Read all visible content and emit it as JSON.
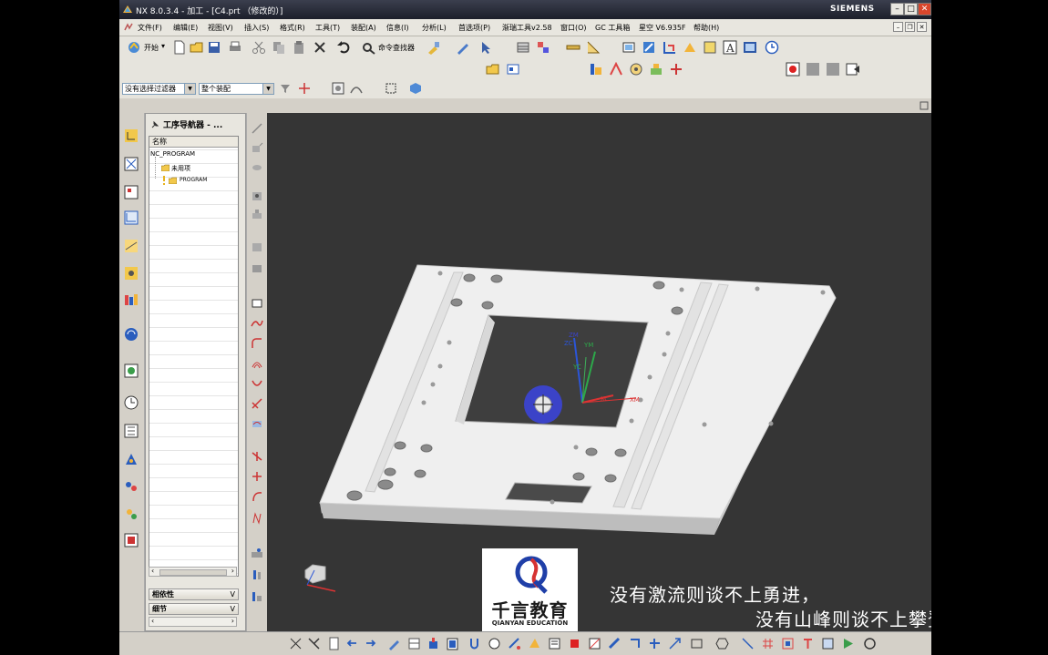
{
  "window": {
    "title": "NX 8.0.3.4 - 加工 - [C4.prt （修改的）]",
    "brand": "SIEMENS"
  },
  "menu": [
    "文件(F)",
    "编辑(E)",
    "视图(V)",
    "插入(S)",
    "格式(R)",
    "工具(T)",
    "装配(A)",
    "信息(I)",
    "分析(L)",
    "首选项(P)",
    "渐瑞工具v2.58",
    "窗口(O)",
    "GC 工具箱",
    "星空 V6.935F",
    "帮助(H)"
  ],
  "toolbar": {
    "start_label": "开始",
    "command_finder_label": "命令查找器"
  },
  "selection_bar": {
    "filter_value": "没有选择过滤器",
    "scope_value": "整个装配"
  },
  "navigator": {
    "title": "工序导航器 - ...",
    "column_name": "名称",
    "tree": [
      {
        "label": "NC_PROGRAM"
      },
      {
        "label": "未用项"
      },
      {
        "label": "PROGRAM"
      }
    ],
    "sections": [
      "相依性",
      "细节"
    ]
  },
  "viewport": {
    "csys_labels": [
      "ZM",
      "YM",
      "ZC",
      "YC",
      "XC",
      "XM"
    ]
  },
  "overlay": {
    "logo_cn": "千言教育",
    "logo_en": "QIANYAN EDUCATION",
    "subtitle_line1": "没有激流则谈不上勇进，",
    "subtitle_line2": "没有山峰则谈不上攀登。"
  },
  "colors": {
    "viewport_bg": "#353535",
    "accent_red": "#d9462c",
    "wcs_blue": "#3b43c8"
  }
}
